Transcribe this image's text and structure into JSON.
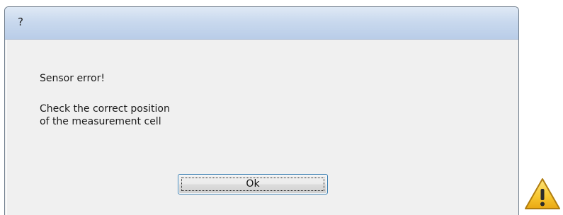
{
  "window": {
    "title": "?"
  },
  "message": {
    "line1": "Sensor error!",
    "line2": "Check the correct position",
    "line3": "of the measurement cell"
  },
  "buttons": {
    "ok_label": "Ok"
  },
  "icons": {
    "status": "warning-icon"
  },
  "colors": {
    "titlebar": "#c9d9ee",
    "client_background": "#f0f0f0",
    "button_border": "#3c7fb1",
    "warning_fill": "#f7c62f"
  }
}
